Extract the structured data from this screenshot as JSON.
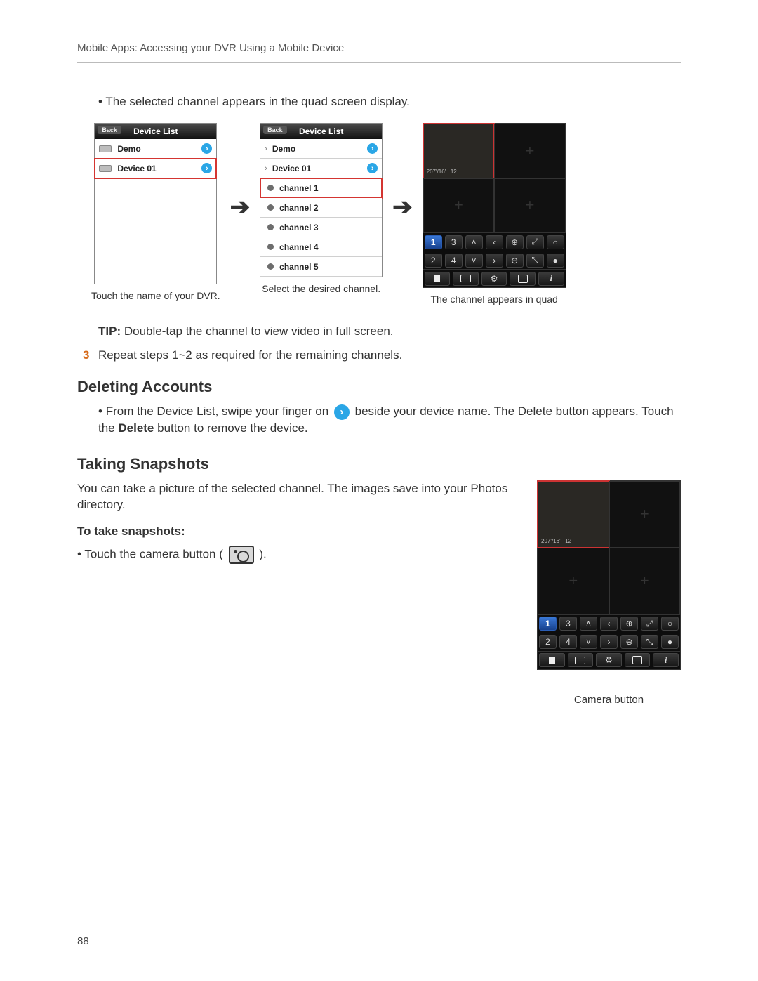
{
  "header": {
    "title": "Mobile Apps: Accessing your DVR Using a Mobile Device"
  },
  "intro_bullet": "The selected channel appears in the quad screen display.",
  "panel_a": {
    "title": "Device List",
    "back": "Back",
    "rows": [
      {
        "label": "Demo"
      },
      {
        "label": "Device 01"
      }
    ],
    "caption": "Touch the name of your DVR."
  },
  "panel_b": {
    "title": "Device List",
    "back": "Back",
    "devices": [
      {
        "label": "Demo"
      },
      {
        "label": "Device 01"
      }
    ],
    "channels": [
      {
        "label": "channel 1"
      },
      {
        "label": "channel 2"
      },
      {
        "label": "channel 3"
      },
      {
        "label": "channel 4"
      },
      {
        "label": "channel 5"
      }
    ],
    "caption": "Select the desired channel."
  },
  "panel_c": {
    "caption": "The channel appears in quad"
  },
  "tip": {
    "prefix": "TIP:",
    "text": " Double-tap the channel to view video in full screen."
  },
  "step3": {
    "num": "3",
    "text": "Repeat steps 1~2 as required for the remaining channels."
  },
  "sec_del": {
    "title": "Deleting Accounts",
    "bullet_a": "From the Device List, swipe your finger on ",
    "bullet_b": " beside your device name. The Delete button appears. Touch the ",
    "bold": "Delete",
    "bullet_c": " button to remove the device."
  },
  "sec_snap": {
    "title": "Taking Snapshots",
    "desc": "You can take a picture of the selected channel. The images save into your Photos directory.",
    "subhead": "To take snapshots:",
    "bullet_a": "Touch the camera button ( ",
    "bullet_b": " ).",
    "callout": "Camera button"
  },
  "viewer": {
    "btns_row1": [
      "1",
      "3",
      "˄",
      "‹",
      "⊕",
      "⤢",
      "○"
    ],
    "btns_row2": [
      "2",
      "4",
      "˅",
      "›",
      "⊖",
      "⤡",
      "●"
    ]
  },
  "page_number": "88"
}
